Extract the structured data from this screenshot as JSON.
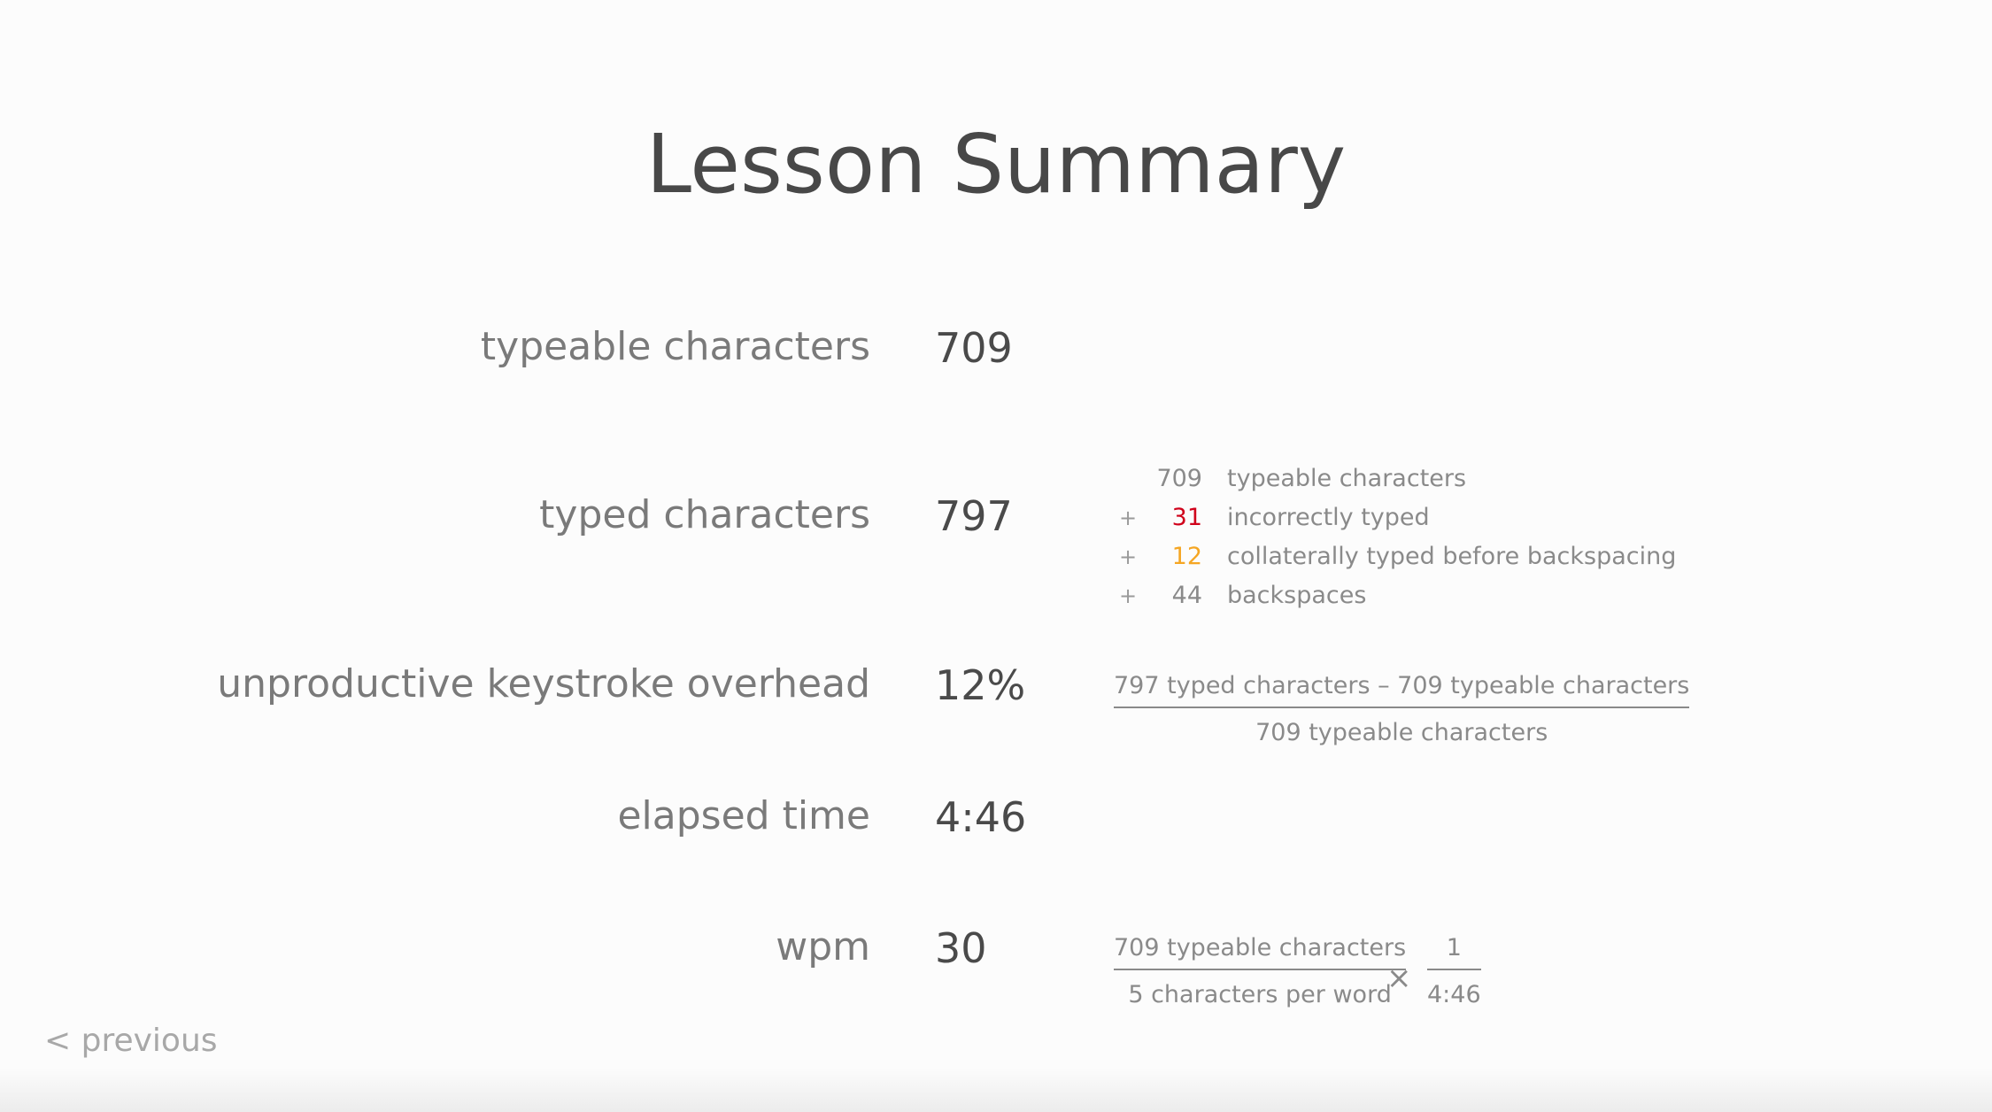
{
  "page": {
    "title": "Lesson Summary"
  },
  "metrics": {
    "typeable": {
      "label": "typeable characters",
      "value": "709"
    },
    "typed": {
      "label": "typed characters",
      "value": "797"
    },
    "overhead": {
      "label": "unproductive keystroke overhead",
      "value": "12%"
    },
    "elapsed": {
      "label": "elapsed time",
      "value": "4:46"
    },
    "wpm": {
      "label": "wpm",
      "value": "30"
    }
  },
  "typed_breakdown": {
    "plus": "+",
    "rows": [
      {
        "number": "709",
        "text": "typeable characters"
      },
      {
        "number": "31",
        "text": "incorrectly typed"
      },
      {
        "number": "12",
        "text": "collaterally typed before backspacing"
      },
      {
        "number": "44",
        "text": "backspaces"
      }
    ]
  },
  "overhead_formula": {
    "numerator": "797 typed characters – 709 typeable characters",
    "denominator": "709 typeable characters"
  },
  "wpm_formula": {
    "left_numerator": "709 typeable characters",
    "left_denominator": "5 characters per word",
    "operator": "×",
    "right_numerator": "1",
    "right_denominator": "4:46"
  },
  "nav": {
    "previous_label": "< previous"
  },
  "colors": {
    "error_red": "#d0021b",
    "collateral_orange": "#f5a623"
  }
}
